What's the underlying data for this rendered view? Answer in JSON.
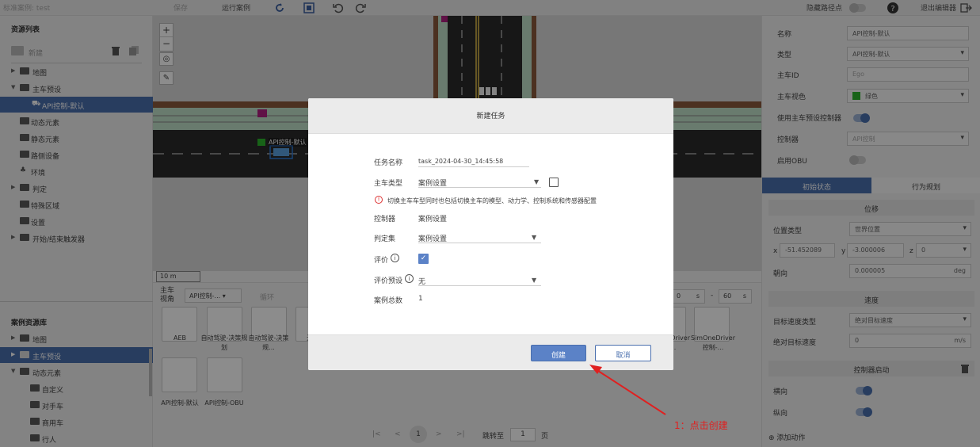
{
  "topbar": {
    "case_title": "标准案例: test",
    "save": "保存",
    "run_case": "运行案例",
    "hide_path": "隐藏路径点",
    "exit_editor": "退出编辑器"
  },
  "left": {
    "resource_title": "资源列表",
    "new_label": "新建",
    "tree": [
      {
        "label": "地图"
      },
      {
        "label": "主车预设"
      },
      {
        "label": "API控制-默认"
      },
      {
        "label": "动态元素"
      },
      {
        "label": "静态元素"
      },
      {
        "label": "路侧设备"
      },
      {
        "label": "环境"
      },
      {
        "label": "判定"
      },
      {
        "label": "特殊区域"
      },
      {
        "label": "设置"
      },
      {
        "label": "开始/结束触发器"
      }
    ],
    "case_lib_title": "案例资源库",
    "case_tree": [
      {
        "label": "地图"
      },
      {
        "label": "主车预设"
      },
      {
        "label": "动态元素"
      },
      {
        "label": "自定义"
      },
      {
        "label": "对手车"
      },
      {
        "label": "商用车"
      },
      {
        "label": "行人"
      }
    ]
  },
  "map": {
    "vehicle_label": "API控制-默认",
    "scale": "10 m"
  },
  "assets": {
    "host_view_label": "主车视角",
    "host_view_select": "API控制-...",
    "loop_label": "循环",
    "speed_s1": "0",
    "speed_unit1": "s",
    "speed_dash": "-",
    "speed_s2": "60",
    "speed_unit2": "s",
    "row1_labels": [
      "AEB",
      "自动驾驶-决策规划",
      "自动驾驶-决策规...",
      "无..."
    ],
    "row1_right_labels": [
      "SimOneDriver控制-...",
      "SimOneDriver控制-..."
    ],
    "row2_labels": [
      "API控制-默认",
      "API控制-OBU"
    ],
    "pager_current": "1",
    "jump_to": "跳转至",
    "jump_value": "1",
    "page_unit": "页"
  },
  "right": {
    "name_label": "名称",
    "name_value": "API控制-默认",
    "type_label": "类型",
    "type_value": "API控制-默认",
    "hostid_label": "主车ID",
    "hostid_placeholder": "Ego",
    "color_label": "主车视色",
    "color_value": "绿色",
    "use_ctrl_label": "使用主车预设控制器",
    "controller_label": "控制器",
    "controller_value": "API控制",
    "obu_label": "启用OBU",
    "tab_initial": "初始状态",
    "tab_behavior": "行为规划",
    "position_head": "位移",
    "pos_type_label": "位置类型",
    "pos_type_value": "世界位置",
    "x_label": "x",
    "x_value": "-51.452089",
    "y_label": "y",
    "y_value": "-3.000006",
    "z_label": "z",
    "z_value": "0",
    "heading_label": "朝向",
    "heading_value": "0.000005",
    "heading_unit": "deg",
    "speed_head": "速度",
    "target_speed_type_label": "目标速度类型",
    "target_speed_type_value": "绝对目标速度",
    "abs_speed_label": "绝对目标速度",
    "abs_speed_value": "0",
    "abs_speed_unit": "m/s",
    "ctrl_start_head": "控制器启动",
    "lateral_label": "横向",
    "longitudinal_label": "纵向",
    "add_action": "添加动作"
  },
  "modal": {
    "title": "新建任务",
    "task_name_label": "任务名称",
    "task_name_value": "task_2024-04-30_14:45:58",
    "host_type_label": "主车类型",
    "host_type_value": "案例设置",
    "warning": "切换主车车型同时也包括切换主车的模型、动力学、控制系统和传感器配置",
    "controller_label": "控制器",
    "controller_value": "案例设置",
    "judge_label": "判定集",
    "judge_value": "案例设置",
    "eval_label": "评价",
    "eval_preset_label": "评价预设",
    "eval_preset_value": "无",
    "total_label": "案例总数",
    "total_value": "1",
    "create": "创建",
    "cancel": "取消"
  },
  "annotation": "1：点击创建",
  "colors": {
    "accent": "#4a6fae",
    "primary_button": "#5b82c7",
    "annotation": "#e02020",
    "vehicle_green": "#2db52d"
  }
}
